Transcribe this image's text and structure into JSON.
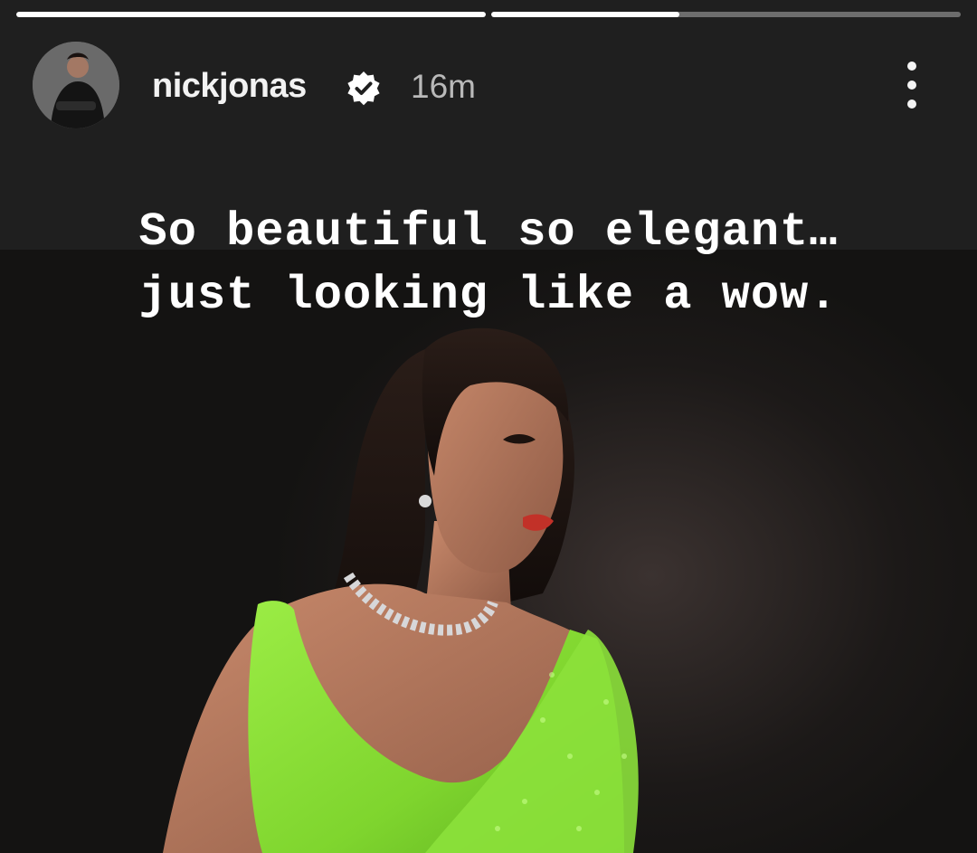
{
  "story": {
    "progress": [
      1.0,
      0.4
    ],
    "user": {
      "username": "nickjonas",
      "verified": true,
      "posted_ago": "16m",
      "avatar_icon": "profile-photo"
    },
    "caption_lines": [
      "So beautiful so elegant…",
      "just looking like a wow."
    ],
    "colors": {
      "background": "#1f1f1f",
      "saree_green": "#8fe23a",
      "text": "#ffffff",
      "timestamp": "#b9b9b9"
    }
  }
}
